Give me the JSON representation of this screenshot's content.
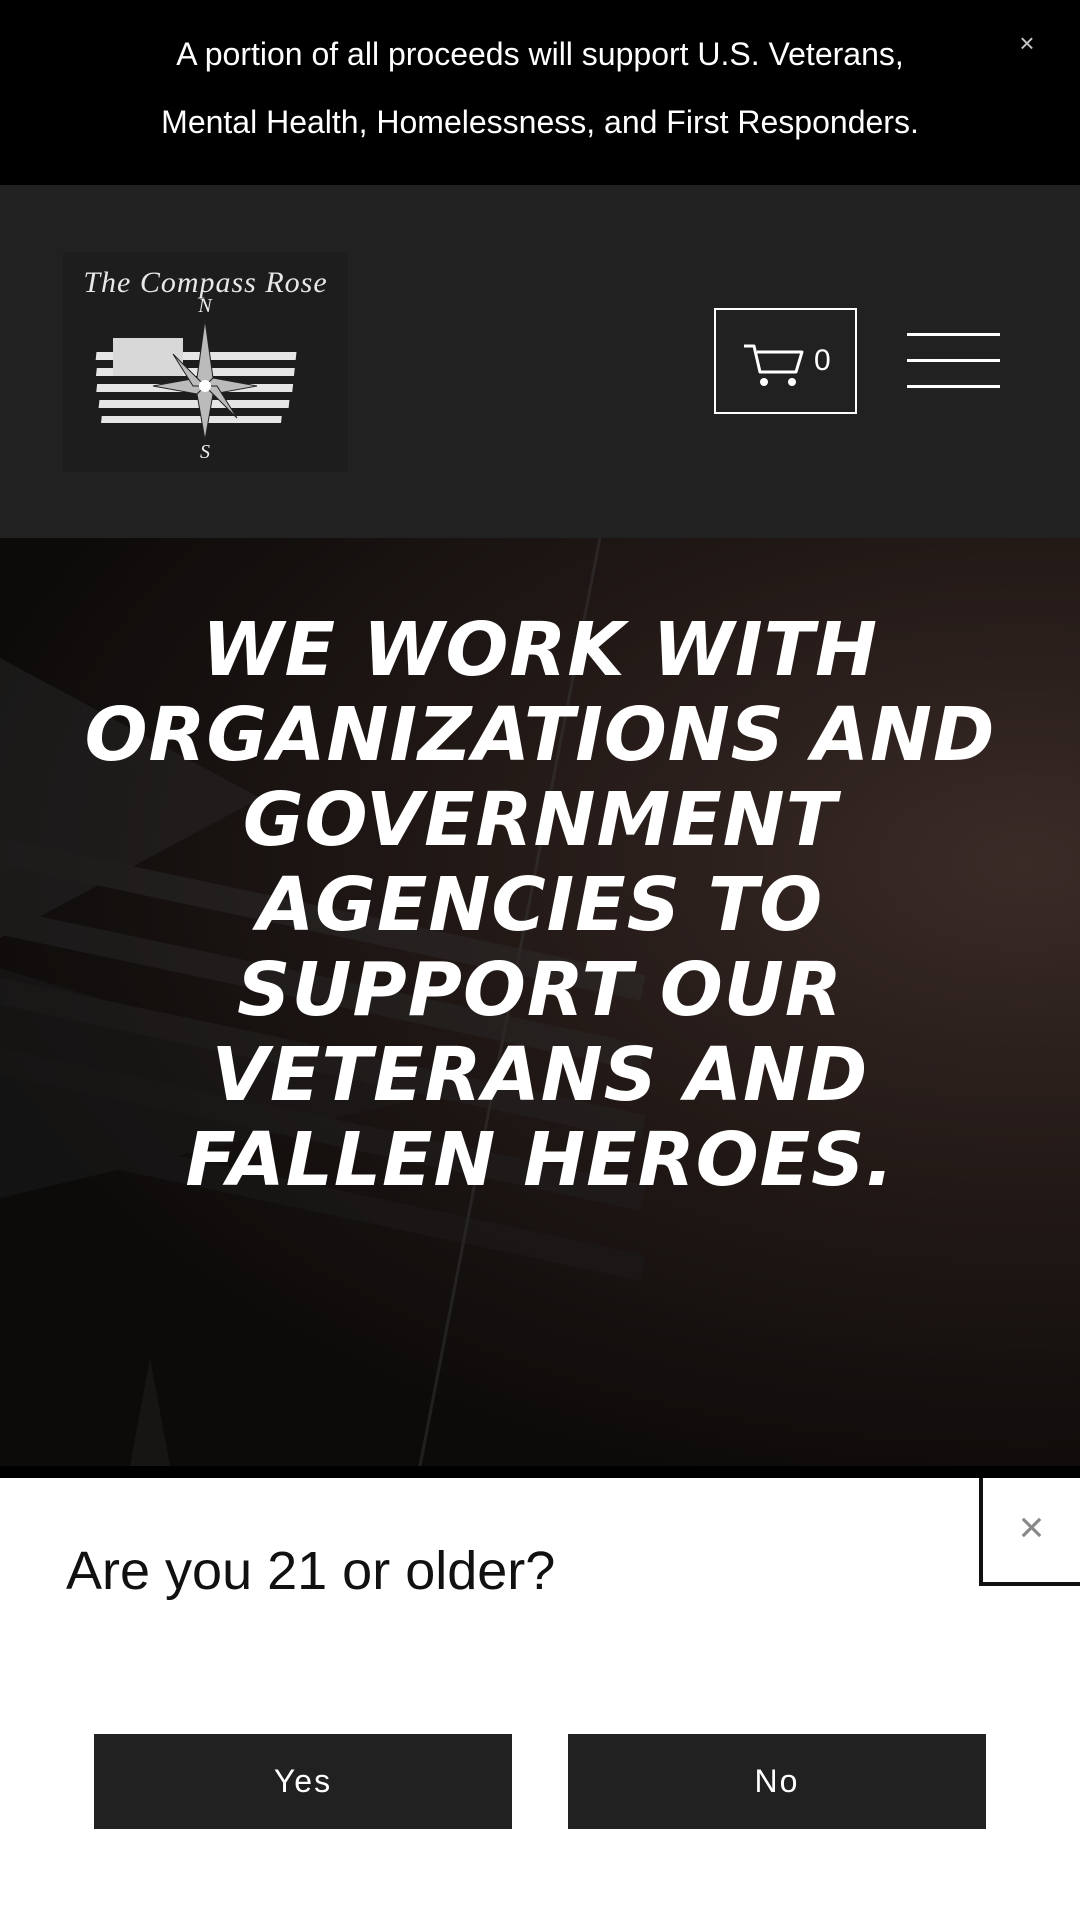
{
  "announcement": {
    "line1": "A portion of all proceeds will support U.S. Veterans,",
    "line2": "Mental Health, Homelessness, and First Responders.",
    "close": "×"
  },
  "header": {
    "logo_text": "The Compass Rose",
    "cart_count": "0"
  },
  "hero": {
    "title": "We work with organizations and government agencies to support our veterans and fallen heroes."
  },
  "age_gate": {
    "question": "Are you 21 or older?",
    "close": "×",
    "yes_label": "Yes",
    "no_label": "No"
  }
}
